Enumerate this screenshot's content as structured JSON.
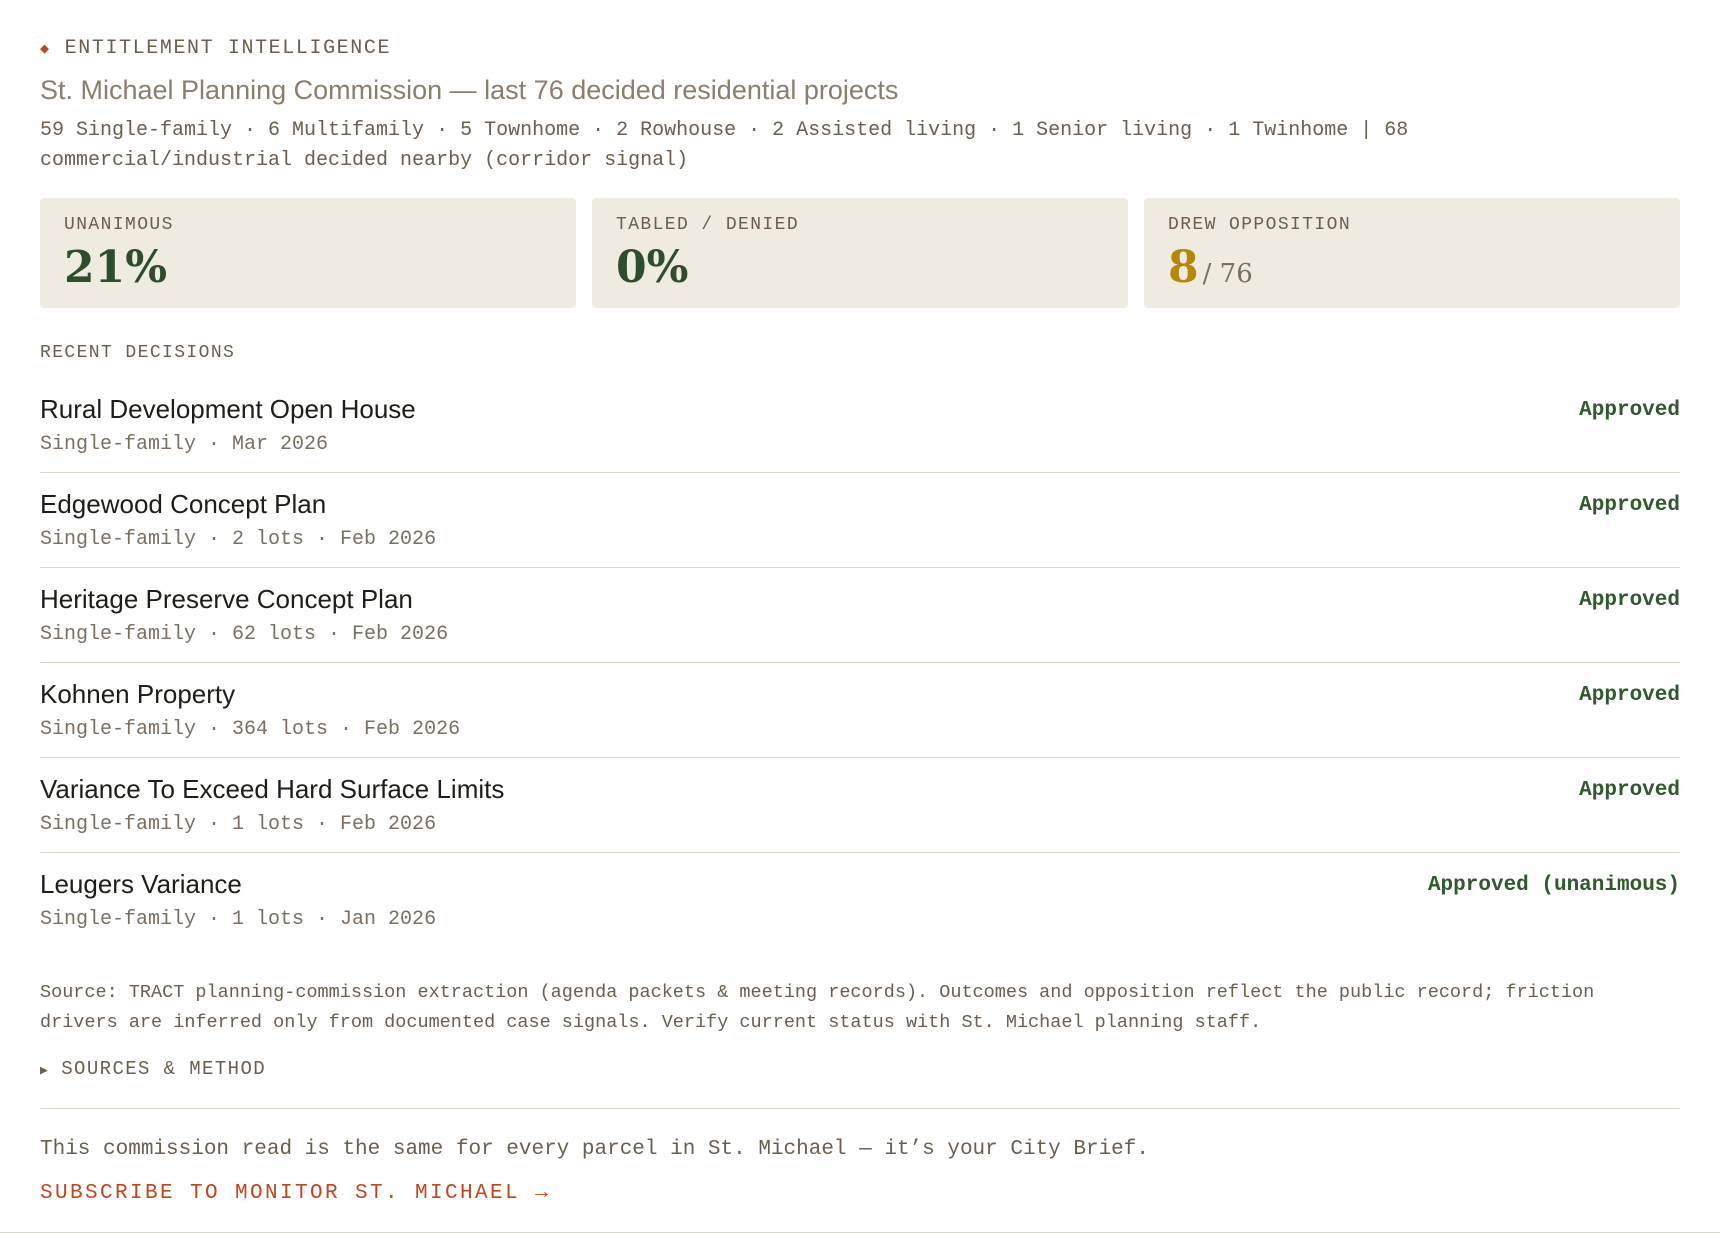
{
  "header": {
    "eyebrow": "ENTITLEMENT INTELLIGENCE",
    "eyebrow_icon": "diamond-icon",
    "subtitle": "St. Michael Planning Commission — last 76 decided residential projects",
    "mix": "59 Single-family · 6 Multifamily · 5 Townhome · 2 Rowhouse · 2 Assisted living · 1 Senior living · 1 Twinhome  |  68 commercial/industrial decided nearby (corridor signal)"
  },
  "stats": {
    "unanimous": {
      "label": "UNANIMOUS",
      "value": "21%"
    },
    "tabled": {
      "label": "TABLED / DENIED",
      "value": "0%"
    },
    "opposition": {
      "label": "DREW OPPOSITION",
      "value": "8",
      "denominator": "/ 76"
    }
  },
  "recent": {
    "label": "RECENT DECISIONS",
    "items": [
      {
        "title": "Rural Development Open House",
        "meta": "Single-family · Mar 2026",
        "outcome": "Approved"
      },
      {
        "title": "Edgewood Concept Plan",
        "meta": "Single-family · 2 lots · Feb 2026",
        "outcome": "Approved"
      },
      {
        "title": "Heritage Preserve Concept Plan",
        "meta": "Single-family · 62 lots · Feb 2026",
        "outcome": "Approved"
      },
      {
        "title": "Kohnen Property",
        "meta": "Single-family · 364 lots · Feb 2026",
        "outcome": "Approved"
      },
      {
        "title": "Variance To Exceed Hard Surface Limits",
        "meta": "Single-family · 1 lots · Feb 2026",
        "outcome": "Approved"
      },
      {
        "title": "Leugers Variance",
        "meta": "Single-family · 1 lots · Jan 2026",
        "outcome": "Approved (unanimous)"
      }
    ]
  },
  "source_note": "Source: TRACT planning-commission extraction (agenda packets & meeting records). Outcomes and opposition reflect the public record; friction drivers are inferred only from documented case signals. Verify current status with St. Michael planning staff.",
  "sources_toggle": {
    "label": "SOURCES & METHOD",
    "icon": "triangle-right-icon"
  },
  "brief_text": "This commission read is the same for every parcel in St. Michael — it’s your City Brief.",
  "cta": {
    "label": "SUBSCRIBE TO MONITOR ST. MICHAEL →"
  },
  "colors": {
    "accent": "#c0461e",
    "green": "#2e5a2c",
    "gold": "#b8860b",
    "card_bg": "#efebe0"
  }
}
